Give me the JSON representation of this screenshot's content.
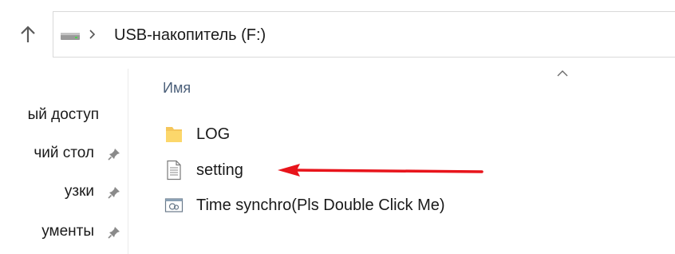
{
  "address": {
    "path_label": "USB-накопитель (F:)"
  },
  "nav": {
    "items": [
      {
        "label": "ый доступ",
        "pinned": false
      },
      {
        "label": "чий стол",
        "pinned": true
      },
      {
        "label": "узки",
        "pinned": true
      },
      {
        "label": "ументы",
        "pinned": true
      }
    ]
  },
  "list": {
    "column_name": "Имя",
    "files": [
      {
        "name": "LOG",
        "icon": "folder-icon"
      },
      {
        "name": "setting",
        "icon": "text-document-icon"
      },
      {
        "name": "Time synchro(Pls Double Click Me)",
        "icon": "shortcut-icon"
      }
    ]
  },
  "annotation": {
    "arrow_color": "#e8141b",
    "points_to": "setting"
  },
  "colors": {
    "folder": "#f5c65b",
    "header_text": "#4c607a",
    "pin": "#8a8a8a"
  }
}
